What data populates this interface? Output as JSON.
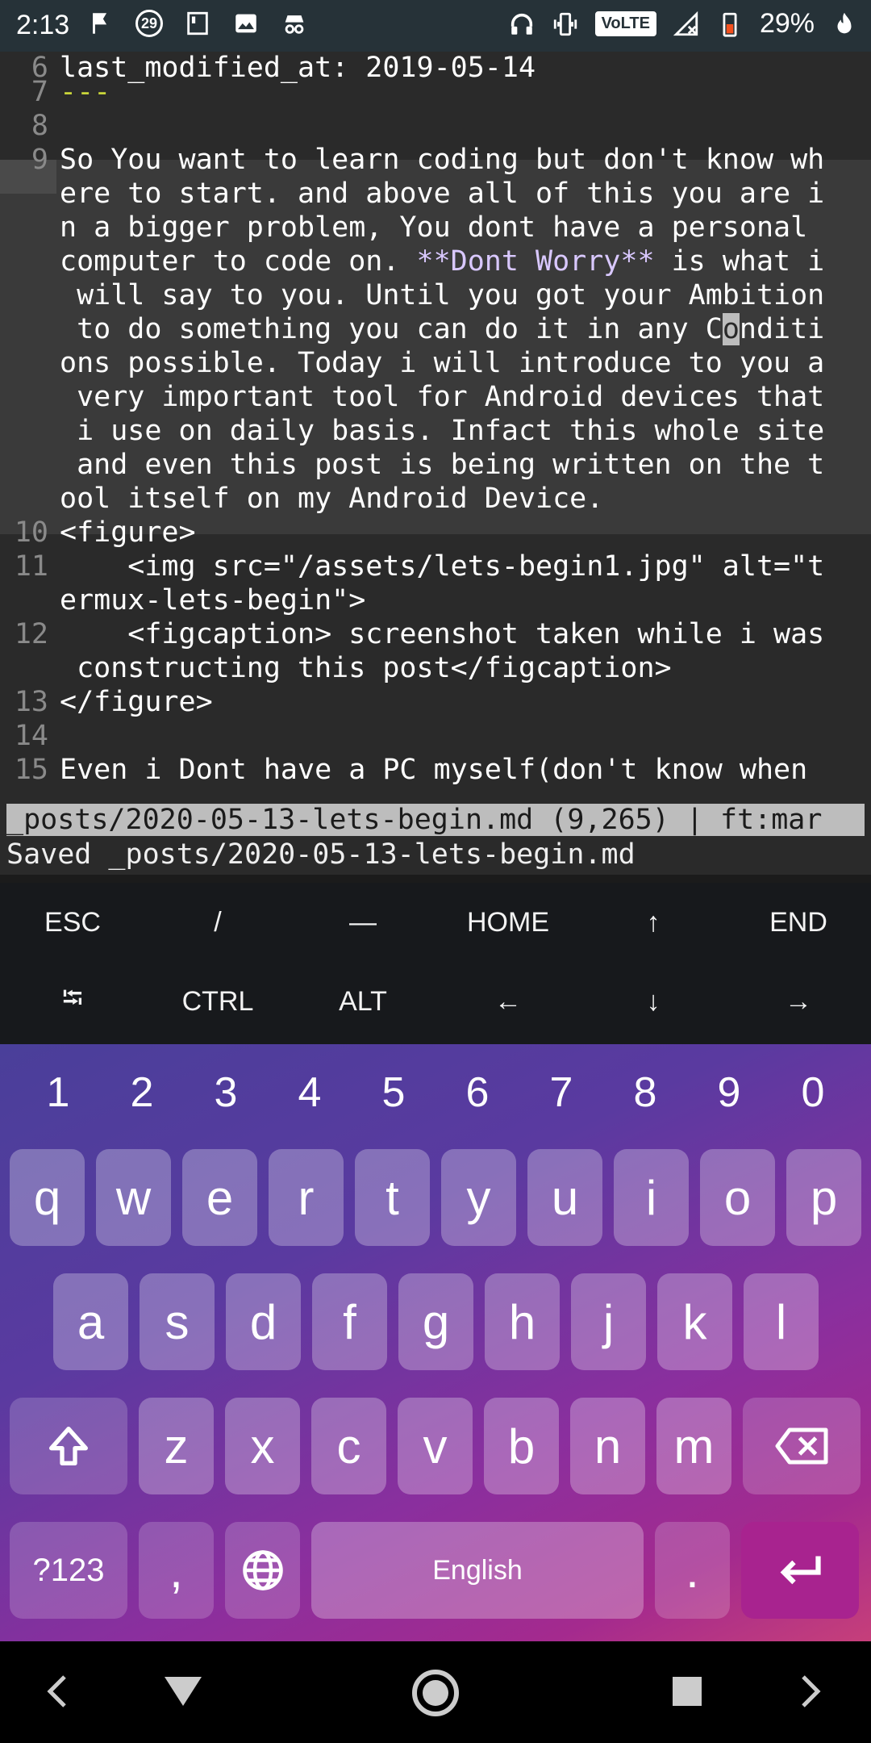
{
  "status_bar": {
    "time": "2:13",
    "notification_badge": "29",
    "network_badge": "VoLTE",
    "battery_percent": "29%",
    "icons": [
      "notification-flag-icon",
      "badge-29-icon",
      "document-icon",
      "image-icon",
      "incognito-icon",
      "headphones-icon",
      "vibrate-icon",
      "volte-icon",
      "signal-icon",
      "battery-icon",
      "flame-icon"
    ]
  },
  "editor": {
    "lines": [
      {
        "num": "6",
        "text": "last_modified_at: 2019-05-14"
      },
      {
        "num": "7",
        "text": "---"
      },
      {
        "num": "8",
        "text": ""
      },
      {
        "num": "9",
        "text": "So You want to learn coding but don't know wh"
      },
      {
        "num": "",
        "text": "ere to start. and above all of this you are i"
      },
      {
        "num": "",
        "text": "n a bigger problem, You dont have a personal "
      },
      {
        "num": "",
        "text_pre": "computer to code on. ",
        "text_bold": "**Dont Worry**",
        "text_post": " is what i"
      },
      {
        "num": "",
        "text": " will say to you. Until you got your Ambition"
      },
      {
        "num": "",
        "text_pre": " to do something you can do it in any C",
        "text_cursor": "o",
        "text_post": "nditi"
      },
      {
        "num": "",
        "text": "ons possible. Today i will introduce to you a"
      },
      {
        "num": "",
        "text": " very important tool for Android devices that"
      },
      {
        "num": "",
        "text": " i use on daily basis. Infact this whole site"
      },
      {
        "num": "",
        "text": " and even this post is being written on the t"
      },
      {
        "num": "",
        "text": "ool itself on my Android Device."
      },
      {
        "num": "10",
        "text": "<figure>"
      },
      {
        "num": "11",
        "text": "    <img src=\"/assets/lets-begin1.jpg\" alt=\"t"
      },
      {
        "num": "",
        "text": "ermux-lets-begin\">"
      },
      {
        "num": "12",
        "text": "    <figcaption> screenshot taken while i was"
      },
      {
        "num": "",
        "text": " constructing this post</figcaption>"
      },
      {
        "num": "13",
        "text": "</figure>"
      },
      {
        "num": "14",
        "text": ""
      },
      {
        "num": "15",
        "text": "Even i Dont have a PC myself(don't know when "
      }
    ],
    "status_line": "_posts/2020-05-13-lets-begin.md (9,265) | ft:mar",
    "message_line": "Saved _posts/2020-05-13-lets-begin.md"
  },
  "extra_keys": {
    "row1": [
      "ESC",
      "/",
      "—",
      "HOME",
      "↑",
      "END"
    ],
    "row2": [
      "⭾",
      "CTRL",
      "ALT",
      "←",
      "↓",
      "→"
    ]
  },
  "keyboard": {
    "numbers": [
      "1",
      "2",
      "3",
      "4",
      "5",
      "6",
      "7",
      "8",
      "9",
      "0"
    ],
    "row1": [
      "q",
      "w",
      "e",
      "r",
      "t",
      "y",
      "u",
      "i",
      "o",
      "p"
    ],
    "row2": [
      "a",
      "s",
      "d",
      "f",
      "g",
      "h",
      "j",
      "k",
      "l"
    ],
    "row3": [
      "z",
      "x",
      "c",
      "v",
      "b",
      "n",
      "m"
    ],
    "symbols_key": "?123",
    "comma_key": ",",
    "space_label": "English",
    "period_key": "."
  }
}
